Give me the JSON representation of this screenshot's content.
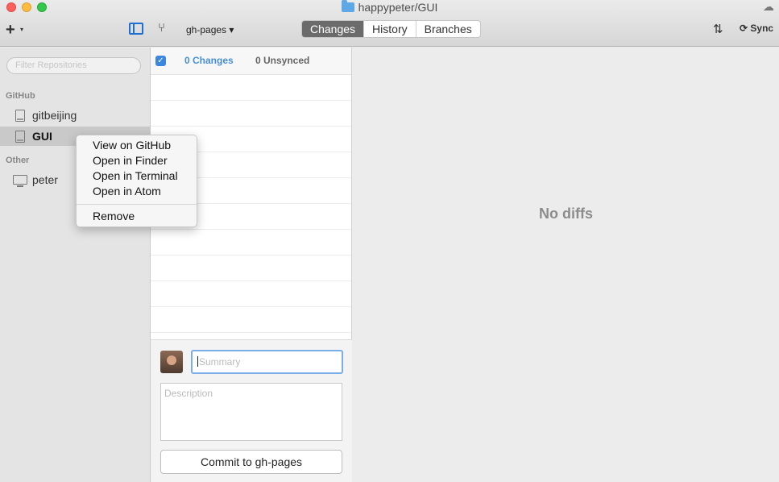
{
  "window": {
    "title": "happypeter/GUI"
  },
  "toolbar": {
    "add_label": "+",
    "add_caret": "▾",
    "branch_name": "gh-pages ▾",
    "tabs": [
      {
        "label": "Changes",
        "active": true
      },
      {
        "label": "History",
        "active": false
      },
      {
        "label": "Branches",
        "active": false
      }
    ],
    "sync_label": "Sync",
    "icons": {
      "cloud": "cloud-upload-icon",
      "branch": "branch-icon",
      "pull_request": "pull-request-icon",
      "sync": "sync-icon"
    }
  },
  "sidebar": {
    "filter_placeholder": "Filter Repositories",
    "sections": [
      {
        "label": "GitHub",
        "repos": [
          {
            "name": "gitbeijing",
            "selected": false
          },
          {
            "name": "GUI",
            "selected": true
          }
        ]
      },
      {
        "label": "Other",
        "repos": [
          {
            "name": "peter",
            "selected": false
          }
        ]
      }
    ]
  },
  "changes": {
    "changes_count": "0 Changes",
    "unsynced_count": "0 Unsynced",
    "summary_placeholder": "Summary",
    "description_placeholder": "Description",
    "commit_label": "Commit to gh-pages"
  },
  "diff": {
    "empty_text": "No diffs"
  },
  "context_menu": {
    "items": [
      "View on GitHub",
      "Open in Finder",
      "Open in Terminal",
      "Open in Atom"
    ],
    "remove_label": "Remove"
  },
  "colors": {
    "accent": "#3b87e0",
    "active_tab": "#6b6b6b",
    "changes_text": "#4a90cf"
  }
}
